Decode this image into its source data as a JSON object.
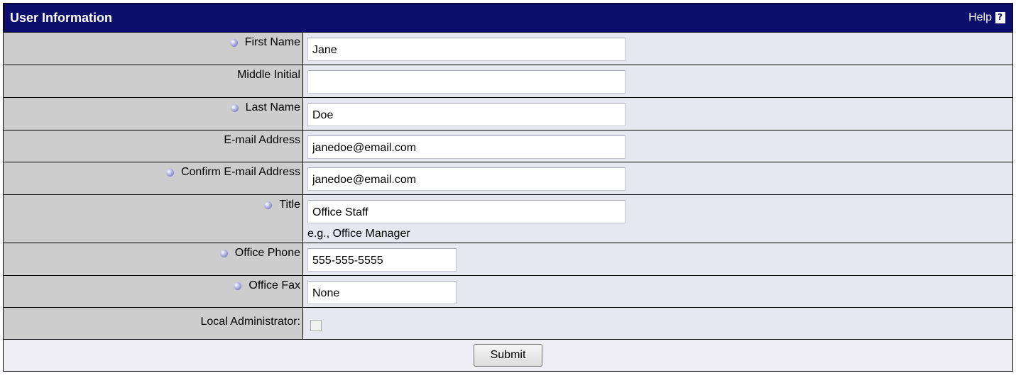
{
  "header": {
    "title": "User Information",
    "help_label": "Help"
  },
  "fields": {
    "first_name": {
      "label": "First Name",
      "value": "Jane",
      "required": true
    },
    "middle_initial": {
      "label": "Middle Initial",
      "value": "",
      "required": false
    },
    "last_name": {
      "label": "Last Name",
      "value": "Doe",
      "required": true
    },
    "email": {
      "label": "E-mail Address",
      "value": "janedoe@email.com",
      "required": false
    },
    "confirm_email": {
      "label": "Confirm E-mail Address",
      "value": "janedoe@email.com",
      "required": true
    },
    "title": {
      "label": "Title",
      "value": "Office Staff",
      "hint": "e.g., Office Manager",
      "required": true
    },
    "office_phone": {
      "label": "Office Phone",
      "value": "555-555-5555",
      "required": true
    },
    "office_fax": {
      "label": "Office Fax",
      "value": "None",
      "required": true
    },
    "local_admin": {
      "label": "Local Administrator:",
      "checked": false
    }
  },
  "actions": {
    "submit_label": "Submit"
  },
  "colors": {
    "header_bg": "#0b0f6b",
    "label_bg": "#cdcdcd",
    "value_bg": "#e7e7f0"
  }
}
